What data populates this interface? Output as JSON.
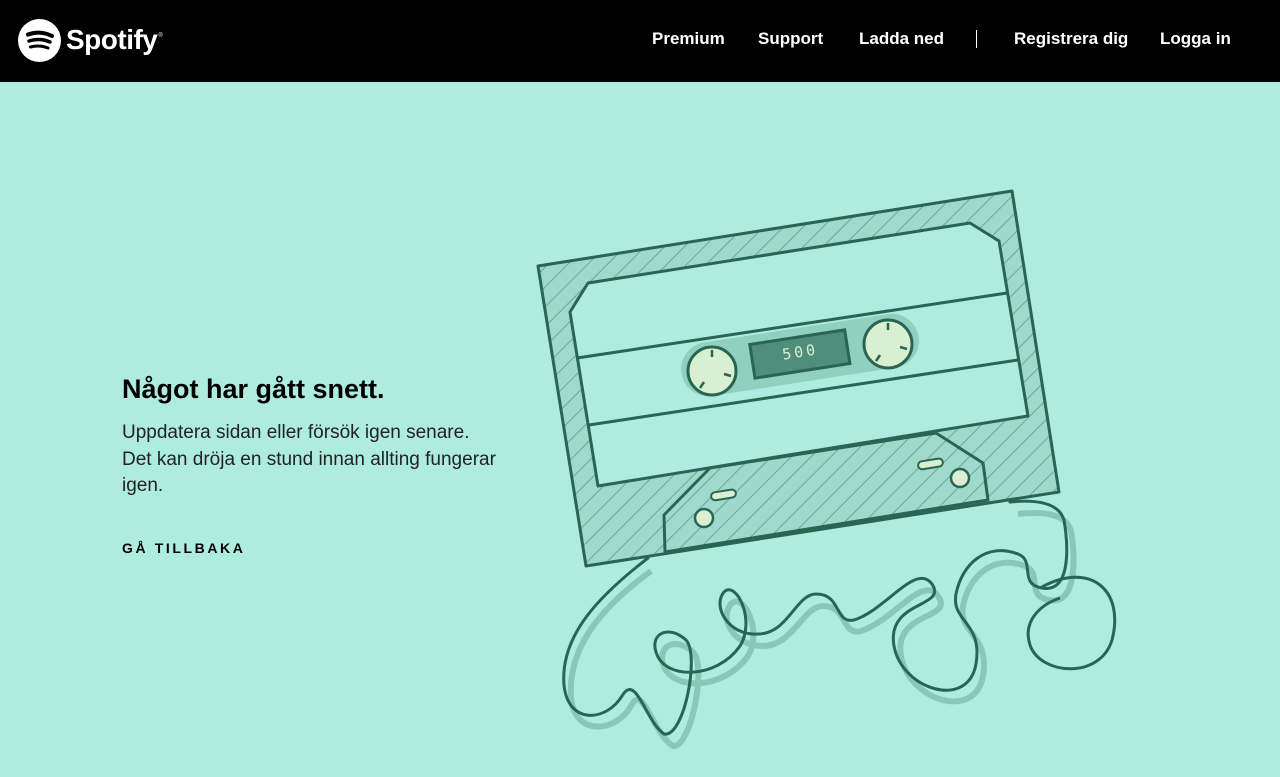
{
  "header": {
    "brand": "Spotify",
    "brand_mark": "®",
    "nav": [
      {
        "label": "Premium"
      },
      {
        "label": "Support"
      },
      {
        "label": "Ladda ned"
      }
    ],
    "account": [
      {
        "label": "Registrera dig"
      },
      {
        "label": "Logga in"
      }
    ]
  },
  "error": {
    "title": "Något har gått snett.",
    "message": "Uppdatera sidan eller försök igen senare. Det kan dröja en stund innan allting fungerar igen.",
    "back_label": "GÅ TILLBAKA",
    "code": "500"
  },
  "colors": {
    "background": "#afece0",
    "header": "#000000",
    "cassette_stroke": "#2a6452",
    "cassette_fill": "#9fd9cc",
    "reel_fill": "#d8f0cf"
  },
  "icons": {
    "logo": "spotify-logo-icon",
    "illustration": "cassette-tape-illustration"
  }
}
